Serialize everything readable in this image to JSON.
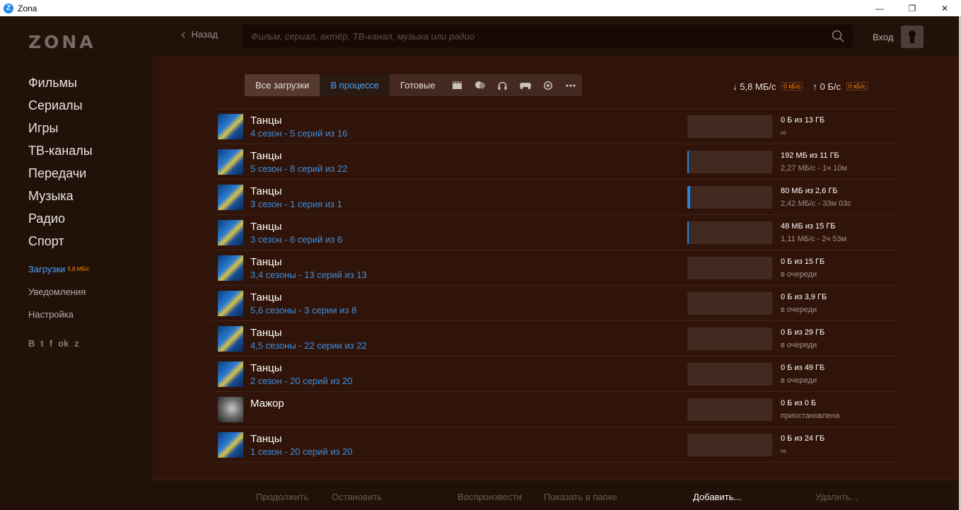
{
  "titlebar": {
    "title": "Zona",
    "app_icon": "Z",
    "minimize": "—",
    "maximize": "❐",
    "close": "✕"
  },
  "logo": "ZONA",
  "sidebar": {
    "main": [
      "Фильмы",
      "Сериалы",
      "Игры",
      "ТВ-каналы",
      "Передачи",
      "Музыка",
      "Радио",
      "Спорт"
    ],
    "downloads_label": "Загрузки",
    "downloads_badge": "5,8 МБ/с",
    "notifications": "Уведомления",
    "settings": "Настройка",
    "social": [
      "B",
      "t",
      "f",
      "ok",
      "z"
    ]
  },
  "header": {
    "back_label": "Назад",
    "search_placeholder": "Фильм, сериал, актёр, ТВ-канал, музыка или радио",
    "login_label": "Вход"
  },
  "tabs": {
    "all": "Все загрузки",
    "in_progress": "В процессе",
    "ready": "Готовые",
    "icons": [
      "film-icon",
      "theater-icon",
      "headphones-icon",
      "gamepad-icon",
      "ball-icon",
      "more-icon"
    ]
  },
  "speeds": {
    "down_arrow": "↓",
    "down": "5,8 МБ/с",
    "down_limit": "0 кБ/с",
    "up_arrow": "↑",
    "up": "0 Б/с",
    "up_limit": "0 кБ/с"
  },
  "downloads": [
    {
      "title": "Танцы",
      "subtitle": "4 сезон - 5 серий из 16",
      "size": "0 Б из 13 ГБ",
      "status": "∞",
      "progress": 0,
      "thumb": "color"
    },
    {
      "title": "Танцы",
      "subtitle": "5 сезон - 8 серий из 22",
      "size": "192 МБ из 11 ГБ",
      "status": "2,27 МБ/с - 1ч 10м",
      "progress": 0.017,
      "thumb": "color"
    },
    {
      "title": "Танцы",
      "subtitle": "3 сезон - 1 серия из 1",
      "size": "80 МБ из 2,6 ГБ",
      "status": "2,42 МБ/с - 33м 03с",
      "progress": 0.03,
      "thumb": "color"
    },
    {
      "title": "Танцы",
      "subtitle": "3 сезон - 6 серий из 6",
      "size": "48 МБ из 15 ГБ",
      "status": "1,11 МБ/с - 2ч 53м",
      "progress": 0.003,
      "thumb": "color"
    },
    {
      "title": "Танцы",
      "subtitle": "3,4 сезоны - 13 серий из 13",
      "size": "0 Б из 15 ГБ",
      "status": "в очереди",
      "progress": 0,
      "thumb": "color"
    },
    {
      "title": "Танцы",
      "subtitle": "5,6 сезоны - 3 серии из 8",
      "size": "0 Б из 3,9 ГБ",
      "status": "в очереди",
      "progress": 0,
      "thumb": "color"
    },
    {
      "title": "Танцы",
      "subtitle": "4,5 сезоны - 22 серии из 22",
      "size": "0 Б из 29 ГБ",
      "status": "в очереди",
      "progress": 0,
      "thumb": "color"
    },
    {
      "title": "Танцы",
      "subtitle": "2 сезон - 20 серий из 20",
      "size": "0 Б из 49 ГБ",
      "status": "в очереди",
      "progress": 0,
      "thumb": "color"
    },
    {
      "title": "Мажор",
      "subtitle": "",
      "size": "0 Б из 0 Б",
      "status": "приостановлена",
      "progress": 0,
      "thumb": "bw"
    },
    {
      "title": "Танцы",
      "subtitle": "1 сезон - 20 серий из 20",
      "size": "0 Б из 24 ГБ",
      "status": "∞",
      "progress": 0,
      "thumb": "color"
    }
  ],
  "actions": {
    "continue": "Продолжить",
    "stop": "Остановить",
    "play": "Воспроизвести",
    "show_folder": "Показать в папке",
    "add": "Добавить...",
    "delete": "Удалить..."
  },
  "colors": {
    "accent": "#1e88e5",
    "link": "#3d8fe0",
    "badge": "#ff8a00"
  }
}
